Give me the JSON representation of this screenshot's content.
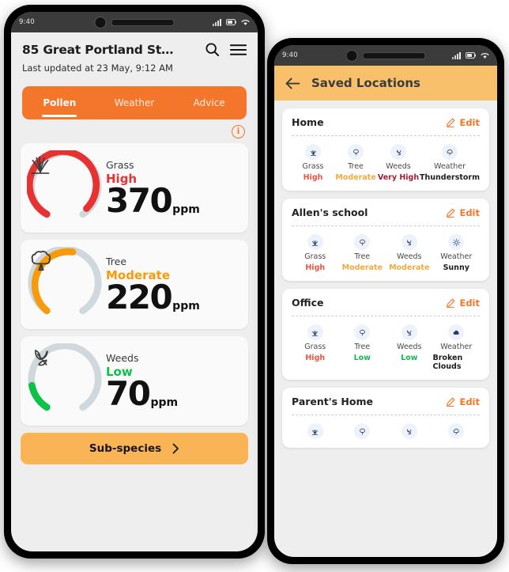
{
  "left_phone": {
    "status": {
      "time": "9:40",
      "icons": [
        "signal-icon",
        "battery-icon",
        "wifi-icon"
      ]
    },
    "header": {
      "title": "85 Great Portland St…",
      "subtitle": "Last updated at 23 May, 9:12 AM",
      "search_icon": "search-icon",
      "menu_icon": "hamburger-menu-icon",
      "info_icon": "info-icon"
    },
    "tabs": [
      {
        "label": "Pollen",
        "active": true
      },
      {
        "label": "Weather",
        "active": false
      },
      {
        "label": "Advice",
        "active": false
      }
    ],
    "pollen_cards": [
      {
        "kind": "Grass",
        "level": "High",
        "value": "370",
        "unit": "ppm",
        "color": "#E63230",
        "icon": "grass-icon",
        "fill": 0.8
      },
      {
        "kind": "Tree",
        "level": "Moderate",
        "value": "220",
        "unit": "ppm",
        "color": "#F79B0C",
        "icon": "tree-icon",
        "fill": 0.52
      },
      {
        "kind": "Weeds",
        "level": "Low",
        "value": "70",
        "unit": "ppm",
        "color": "#0CC24A",
        "icon": "weeds-icon",
        "fill": 0.16
      }
    ],
    "subspecies_button": {
      "label": "Sub-species",
      "chevron": "chevron-right-icon"
    },
    "colors": {
      "tab_bar": "#F4762B",
      "subspecies": "#FAB455",
      "background": "#eeeeee"
    }
  },
  "right_phone": {
    "status": {
      "time": "9:40",
      "icons": [
        "signal-icon",
        "battery-icon",
        "wifi-icon"
      ]
    },
    "appbar": {
      "title": "Saved Locations",
      "back_icon": "arrow-left-icon",
      "color": "#F8C06A"
    },
    "edit_label": "Edit",
    "edit_icon": "pencil-edit-icon",
    "metric_labels": [
      "Grass",
      "Tree",
      "Weeds",
      "Weather"
    ],
    "locations": [
      {
        "name": "Home",
        "metrics": [
          {
            "kind": "Grass",
            "level": "High",
            "color": "#F1533E",
            "icon": "grass-icon"
          },
          {
            "kind": "Tree",
            "level": "Moderate",
            "color": "#F2A93B",
            "icon": "tree-icon"
          },
          {
            "kind": "Weeds",
            "level": "Very High",
            "color": "#A51C30",
            "icon": "weeds-icon"
          },
          {
            "kind": "Weather",
            "level": "Thunderstorm",
            "color": "#1d1d1d",
            "icon": "thunderstorm-icon"
          }
        ]
      },
      {
        "name": "Allen's school",
        "metrics": [
          {
            "kind": "Grass",
            "level": "High",
            "color": "#F1533E",
            "icon": "grass-icon"
          },
          {
            "kind": "Tree",
            "level": "Moderate",
            "color": "#F2A93B",
            "icon": "tree-icon"
          },
          {
            "kind": "Weeds",
            "level": "Moderate",
            "color": "#F2A93B",
            "icon": "weeds-icon"
          },
          {
            "kind": "Weather",
            "level": "Sunny",
            "color": "#1d1d1d",
            "icon": "sunny-icon"
          }
        ]
      },
      {
        "name": "Office",
        "metrics": [
          {
            "kind": "Grass",
            "level": "High",
            "color": "#F1533E",
            "icon": "grass-icon"
          },
          {
            "kind": "Tree",
            "level": "Low",
            "color": "#13B955",
            "icon": "tree-icon"
          },
          {
            "kind": "Weeds",
            "level": "Low",
            "color": "#13B955",
            "icon": "weeds-icon"
          },
          {
            "kind": "Weather",
            "level": "Broken Clouds",
            "color": "#1d1d1d",
            "icon": "cloud-icon"
          }
        ]
      },
      {
        "name": "Parent's Home",
        "metrics": [
          {
            "kind": "Grass",
            "level": "",
            "color": "#F1533E",
            "icon": "grass-icon"
          },
          {
            "kind": "Tree",
            "level": "",
            "color": "#F2A93B",
            "icon": "tree-icon"
          },
          {
            "kind": "Weeds",
            "level": "",
            "color": "#A51C30",
            "icon": "weeds-icon"
          },
          {
            "kind": "Weather",
            "level": "",
            "color": "#1d1d1d",
            "icon": "thunderstorm-icon"
          }
        ]
      }
    ]
  }
}
